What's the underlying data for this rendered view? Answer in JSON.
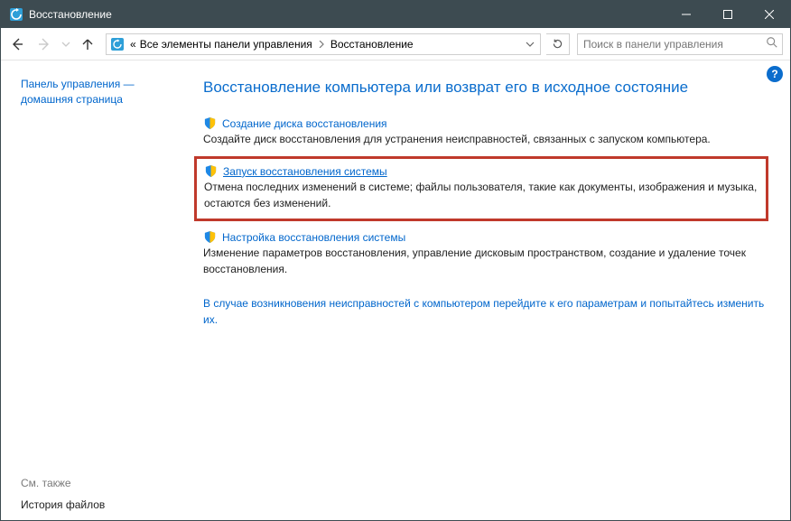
{
  "titlebar": {
    "title": "Восстановление"
  },
  "nav": {
    "breadcrumb_prefix": "«",
    "breadcrumb_1": "Все элементы панели управления",
    "breadcrumb_2": "Восстановление",
    "search_placeholder": "Поиск в панели управления"
  },
  "sidebar": {
    "cp_home": "Панель управления — домашняя страница",
    "see_also": "См. также",
    "file_history": "История файлов"
  },
  "main": {
    "heading": "Восстановление компьютера или возврат его в исходное состояние",
    "sec1": {
      "link": "Создание диска восстановления",
      "desc": "Создайте диск восстановления для устранения неисправностей, связанных с запуском компьютера."
    },
    "sec2": {
      "link": "Запуск восстановления системы",
      "desc": "Отмена последних изменений в системе; файлы пользователя, такие как документы, изображения и музыка, остаются без изменений."
    },
    "sec3": {
      "link": "Настройка восстановления системы",
      "desc": "Изменение параметров восстановления, управление дисковым пространством, создание и удаление точек восстановления."
    },
    "advanced": "В случае возникновения неисправностей с компьютером перейдите к его параметрам и попытайтесь изменить их.",
    "help": "?"
  }
}
